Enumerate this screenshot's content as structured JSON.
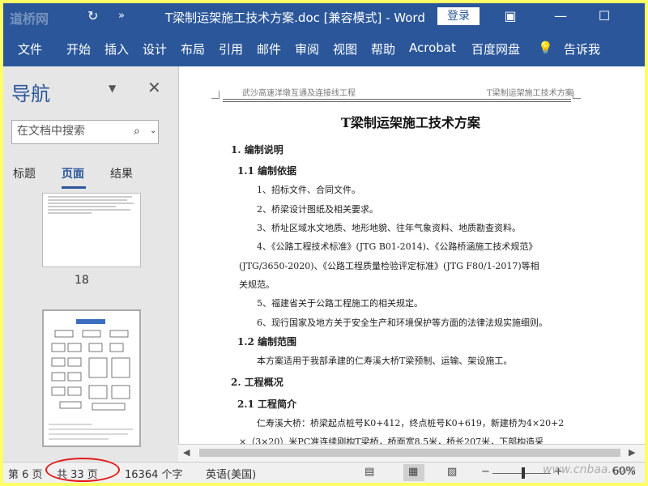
{
  "titlebar": {
    "watermark": "道桥网",
    "title": "T梁制运架施工技术方案.doc [兼容模式]  -  Word",
    "login": "登录"
  },
  "ribbon": {
    "tabs": [
      "文件",
      "开始",
      "插入",
      "设计",
      "布局",
      "引用",
      "邮件",
      "审阅",
      "视图",
      "帮助",
      "Acrobat",
      "百度网盘",
      "告诉我"
    ]
  },
  "nav": {
    "title": "导航",
    "search_placeholder": "在文档中搜索",
    "tabs": [
      "标题",
      "页面",
      "结果"
    ],
    "active_tab": "页面",
    "page_labels": [
      "18"
    ]
  },
  "doc": {
    "header_left": "武沙高速洋墩互通及连接线工程",
    "header_right": "T梁制运架施工技术方案",
    "title": "T梁制运架施工技术方案",
    "lines": [
      "1. 编制说明",
      "1.1 编制依据",
      "1、招标文件、合同文件。",
      "2、桥梁设计图纸及相关要求。",
      "3、桥址区域水文地质、地形地貌、往年气象资料、地质勘查资料。",
      "4、《公路工程技术标准》(JTG B01-2014)、《公路桥涵施工技术规范》",
      "(JTG/3650-2020)、《公路工程质量检验评定标准》(JTG F80/1-2017)等相",
      "关规范。",
      "5、福建省关于公路工程施工的相关规定。",
      "6、现行国家及地方关于安全生产和环境保护等方面的法律法规实施细则。",
      "1.2 编制范围",
      "本方案适用于我部承建的仁寿溪大桥T梁预制、运输、架设施工。",
      "2. 工程概况",
      "2.1 工程简介",
      "仁寿溪大桥：桥梁起点桩号K0+412，终点桩号K0+619，新建桥为4×20+2",
      "×（3×20）米PC准连续刚构T梁桥，桥面宽8.5米，桥长207米，下部构造采"
    ]
  },
  "status": {
    "page": "第 6 页",
    "total": "共 33 页",
    "words": "16364 个字",
    "lang": "英语(美国)",
    "zoom": "60%"
  },
  "site_watermark": "www.cnbaa.com",
  "colors": {
    "ribbon": "#2b579a",
    "annotation": "#e31b1b",
    "outer_border": "#ffff66"
  },
  "icons": [
    "save-icon",
    "undo-icon",
    "more-icon",
    "ribbon-options-icon",
    "minimize-icon",
    "restore-icon",
    "lightbulb-icon",
    "search-icon",
    "close-icon"
  ]
}
